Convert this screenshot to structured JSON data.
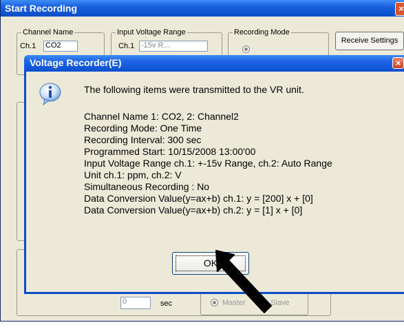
{
  "background_window": {
    "title": "Start Recording",
    "close_glyph": "×",
    "channel_name_group": "Channel Name",
    "ch1_label": "Ch.1",
    "ch1_value": "CO2",
    "input_voltage_group": "Input Voltage Range",
    "input_ch1_label": "Ch.1",
    "input_ch1_value": "-15v R...",
    "recording_mode_group": "Recording Mode",
    "receive_settings_button": "Receive Settings",
    "interval_value": "0",
    "interval_unit": "sec",
    "master_label": "Master",
    "slave_label": "Slave"
  },
  "dialog": {
    "title": "Voltage Recorder(E)",
    "close_glyph": "×",
    "icon": "info-icon",
    "message_header": "The following items were transmitted to the VR unit.",
    "lines": [
      "Channel Name 1: CO2, 2: Channel2",
      "Recording Mode: One Time",
      "Recording Interval: 300 sec",
      "Programmed Start: 10/15/2008 13:00'00",
      "Input Voltage Range ch.1: +-15v Range, ch.2:  Auto Range",
      "Unit ch.1: ppm, ch.2: V",
      "Simultaneous Recording : No",
      "Data Conversion Value(y=ax+b) ch.1: y = [200] x + [0]",
      "Data Conversion Value(y=ax+b) ch.2: y = [1] x + [0]"
    ],
    "ok_button": "OK"
  },
  "colors": {
    "titlebar_blue": "#0a4ec6",
    "dialog_face": "#ece9d8",
    "close_red": "#d9542c"
  }
}
